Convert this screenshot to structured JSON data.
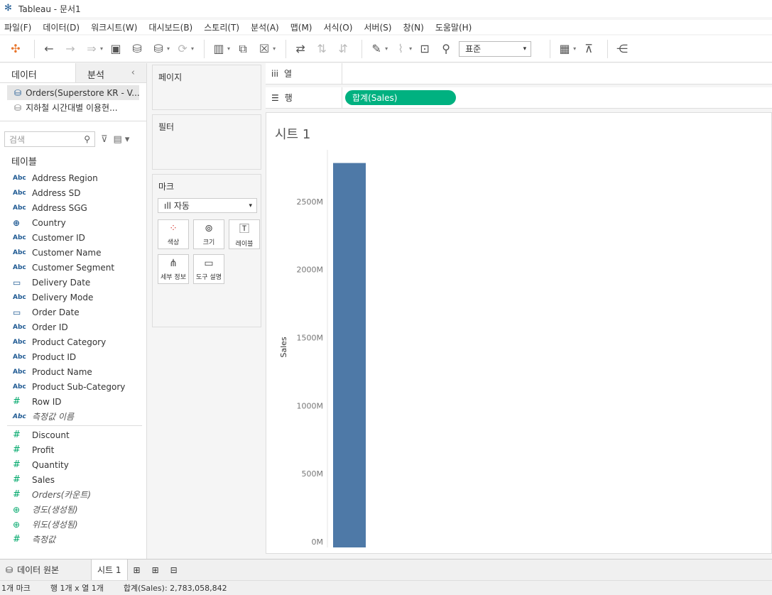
{
  "window": {
    "title": "Tableau - 문서1"
  },
  "menu": [
    "파일(F)",
    "데이터(D)",
    "워크시트(W)",
    "대시보드(B)",
    "스토리(T)",
    "분석(A)",
    "맵(M)",
    "서식(O)",
    "서버(S)",
    "창(N)",
    "도움말(H)"
  ],
  "toolbar": {
    "zoom_value": "표준"
  },
  "left_pane": {
    "tab_data": "데이터",
    "tab_analysis": "분석",
    "datasources": [
      "Orders(Superstore KR - V...",
      "지하철 시간대별 이용현..."
    ],
    "search_placeholder": "검색",
    "section_tables": "테이블",
    "dimensions": [
      {
        "type": "Abc",
        "name": "Address Region"
      },
      {
        "type": "Abc",
        "name": "Address SD"
      },
      {
        "type": "Abc",
        "name": "Address SGG"
      },
      {
        "type": "globe",
        "name": "Country"
      },
      {
        "type": "Abc",
        "name": "Customer ID"
      },
      {
        "type": "Abc",
        "name": "Customer Name"
      },
      {
        "type": "Abc",
        "name": "Customer Segment"
      },
      {
        "type": "date",
        "name": "Delivery Date"
      },
      {
        "type": "Abc",
        "name": "Delivery Mode"
      },
      {
        "type": "date",
        "name": "Order Date"
      },
      {
        "type": "Abc",
        "name": "Order ID"
      },
      {
        "type": "Abc",
        "name": "Product Category"
      },
      {
        "type": "Abc",
        "name": "Product ID"
      },
      {
        "type": "Abc",
        "name": "Product Name"
      },
      {
        "type": "Abc",
        "name": "Product Sub-Category"
      },
      {
        "type": "#",
        "name": "Row ID"
      },
      {
        "type": "Abc",
        "name": "측정값 이름"
      }
    ],
    "measures": [
      {
        "type": "#",
        "name": "Discount"
      },
      {
        "type": "#",
        "name": "Profit"
      },
      {
        "type": "#",
        "name": "Quantity"
      },
      {
        "type": "#",
        "name": "Sales"
      },
      {
        "type": "#",
        "name": "Orders(카운트)"
      },
      {
        "type": "globe",
        "name": "경도(생성됨)"
      },
      {
        "type": "globe",
        "name": "위도(생성됨)"
      },
      {
        "type": "#",
        "name": "측정값"
      }
    ]
  },
  "cards": {
    "pages": "페이지",
    "filters": "필터",
    "marks": "마크",
    "mark_type": "자동",
    "mark_buttons": [
      "색상",
      "크기",
      "레이블",
      "세부 정보",
      "도구 설명"
    ]
  },
  "shelves": {
    "columns_label": "열",
    "rows_label": "행",
    "rows_pill": "합계(Sales)"
  },
  "sheet": {
    "title": "시트 1"
  },
  "chart_data": {
    "type": "bar",
    "categories": [
      ""
    ],
    "values": [
      2783058842
    ],
    "ylabel": "Sales",
    "ylim": [
      0,
      2783058842
    ],
    "yticks": [
      "0M",
      "500M",
      "1000M",
      "1500M",
      "2000M",
      "2500M"
    ],
    "ytick_values": [
      0,
      500000000,
      1000000000,
      1500000000,
      2000000000,
      2500000000
    ],
    "bar_color": "#4e79a7"
  },
  "bottom_tabs": {
    "datasource": "데이터 원본",
    "sheet": "시트 1"
  },
  "status": {
    "marks": "1개 마크",
    "rows_cols": "행 1개 x 열 1개",
    "sum": "합계(Sales): 2,783,058,842"
  }
}
